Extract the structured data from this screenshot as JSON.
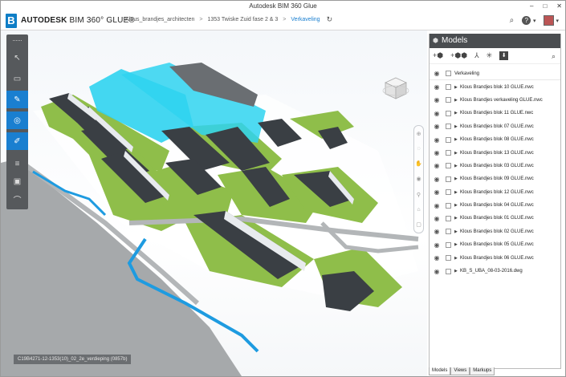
{
  "window": {
    "title": "Autodesk BIM 360 Glue",
    "min": "–",
    "max": "□",
    "close": "✕"
  },
  "app": {
    "logo_letter": "B",
    "brand_prefix": "AUTODESK",
    "brand_name": "BIM 360° GLUE®"
  },
  "breadcrumb": {
    "items": [
      "Klous_brandjes_architecten",
      "1353 Twiske Zuid fase 2 & 3",
      "Verkaveling"
    ],
    "separator": ">"
  },
  "toolbar_right": {
    "search_icon": "⌕",
    "help_icon": "?",
    "help_chevron": "▾",
    "user_chevron": "▾"
  },
  "left_toolbar": {
    "items": [
      {
        "name": "select",
        "glyph": "↖"
      },
      {
        "name": "measure",
        "glyph": "▭"
      },
      {
        "name": "markup",
        "glyph": "✎"
      },
      {
        "name": "clash",
        "glyph": "◎"
      },
      {
        "name": "paint",
        "glyph": "✐"
      },
      {
        "name": "list",
        "glyph": "≡"
      },
      {
        "name": "compare",
        "glyph": "▣"
      },
      {
        "name": "attach",
        "glyph": "⌒"
      }
    ]
  },
  "status_chip": "C19B4271-12-1353(10)_02_2e_verdieping (0857b)",
  "panel": {
    "title": "Models",
    "tools": [
      "+⬢",
      "+⬢⬢",
      "⅄",
      "✳",
      "⬇"
    ],
    "header_row": "Verkaveling",
    "models": [
      "Klous Brandjes blok 10 GLUE.nwc",
      "Klous Brandjes verkaveling GLUE.nwc",
      "Klous Brandjes blok 11 GLUE.nwc",
      "Klous Brandjes blok 07 GLUE.nwc",
      "Klous Brandjes blok 08 GLUE.nwc",
      "Klous Brandjes blok 13 GLUE.nwc",
      "Klous Brandjes blok 03 GLUE.nwc",
      "Klous Brandjes blok 09 GLUE.nwc",
      "Klous Brandjes blok 12 GLUE.nwc",
      "Klous Brandjes blok 04 GLUE.nwc",
      "Klous Brandjes blok 01 GLUE.nwc",
      "Klous Brandjes blok 02 GLUE.nwc",
      "Klous Brandjes blok 05 GLUE.nwc",
      "Klous Brandjes blok 06 GLUE.nwc",
      "KB_S_UBA_08-03-2016.dwg"
    ]
  },
  "tabs": [
    "Models",
    "Views",
    "Markups"
  ],
  "colors": {
    "accent": "#1a7fd0",
    "highlight": "#2fd3f0",
    "grass": "#8fbe4a",
    "road": "#a9acae",
    "water": "#1e9be0",
    "roof": "#3a3f44"
  }
}
